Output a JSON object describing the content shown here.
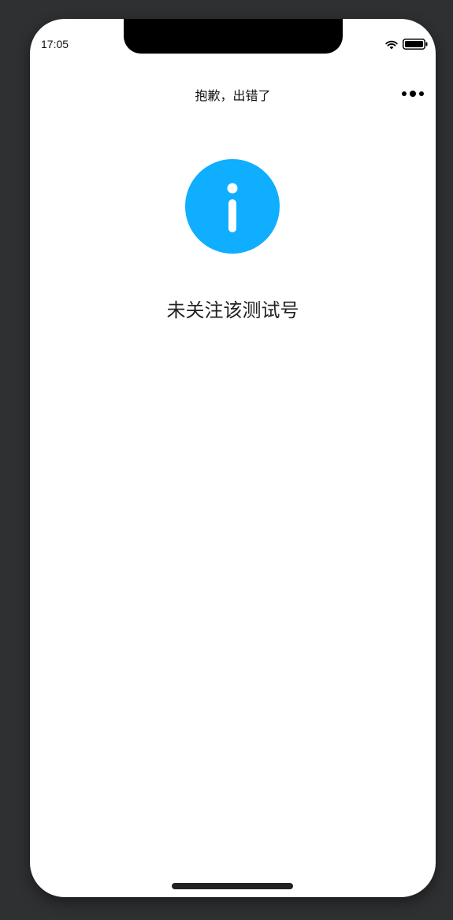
{
  "status_bar": {
    "time": "17:05"
  },
  "nav": {
    "title": "抱歉，出错了",
    "more_icon": "more-dots-icon"
  },
  "content": {
    "icon": "info-icon",
    "icon_color": "#10AEFF",
    "message": "未关注该测试号"
  }
}
